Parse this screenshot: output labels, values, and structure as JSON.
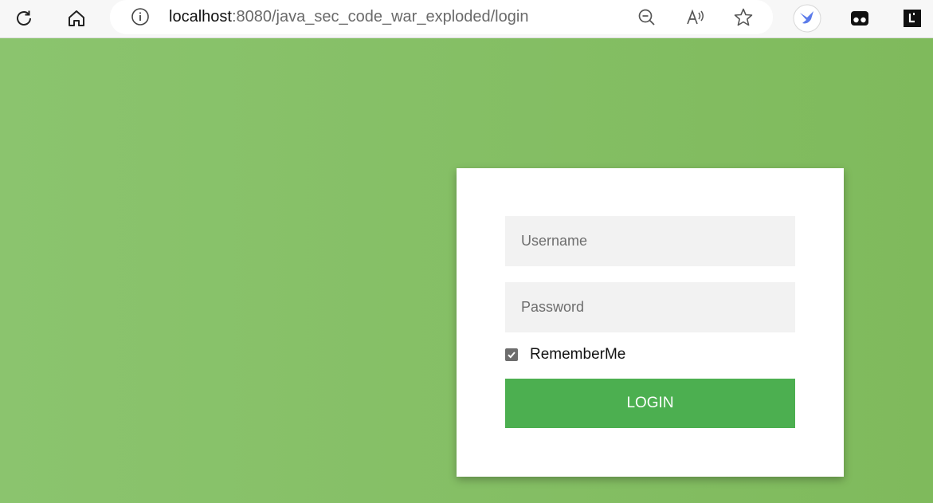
{
  "browser": {
    "url_host": "localhost",
    "url_path": ":8080/java_sec_code_war_exploded/login",
    "icons": [
      "reload-icon",
      "home-icon",
      "info-icon",
      "zoom-out-icon",
      "read-aloud-icon",
      "favorite-star-icon",
      "bird-extension-icon",
      "tab-extension-icon",
      "l-extension-icon"
    ]
  },
  "login": {
    "username_placeholder": "Username",
    "password_placeholder": "Password",
    "remember_label": "RememberMe",
    "remember_checked": true,
    "button_label": "LOGIN"
  },
  "colors": {
    "background": "#86bf66",
    "button": "#4caf50",
    "card": "#ffffff"
  }
}
